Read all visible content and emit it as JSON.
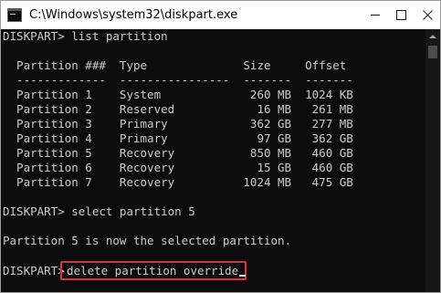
{
  "window": {
    "title": "C:\\Windows\\system32\\diskpart.exe"
  },
  "icons": {
    "app": "console-app-icon",
    "minimize": "minimize-icon",
    "maximize": "maximize-icon",
    "close": "close-icon"
  },
  "colors": {
    "console_background": "#0c0c0c",
    "console_text": "#cccccc",
    "highlight_border": "#e0343c"
  },
  "console": {
    "lines": [
      "DISKPART> list partition",
      "",
      "  Partition ###  Type              Size     Offset",
      "  -------------  ----------------  -------  -------",
      "  Partition 1    System             260 MB  1024 KB",
      "  Partition 2    Reserved            16 MB   261 MB",
      "  Partition 3    Primary            362 GB   277 MB",
      "  Partition 4    Primary             97 GB   362 GB",
      "  Partition 5    Recovery           850 MB   460 GB",
      "  Partition 6    Recovery            15 GB   460 GB",
      "  Partition 7    Recovery          1024 MB   475 GB",
      "",
      "DISKPART> select partition 5",
      "",
      "Partition 5 is now the selected partition.",
      ""
    ],
    "prompt": "DISKPART>",
    "current_command": "delete partition override"
  }
}
